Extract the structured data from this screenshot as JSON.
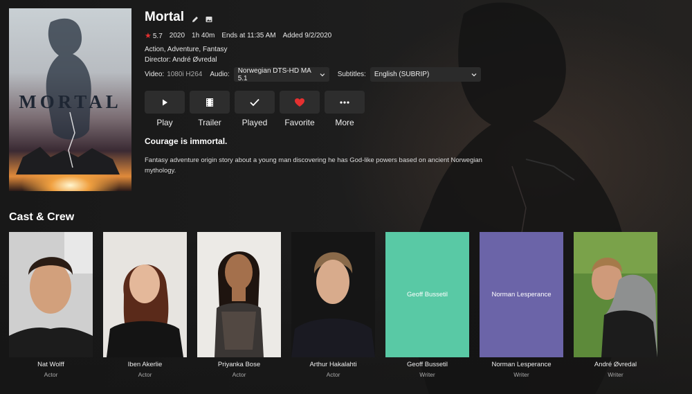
{
  "item": {
    "title": "Mortal",
    "poster_text": "MORTAL",
    "rating": "5.7",
    "year": "2020",
    "runtime": "1h 40m",
    "ends_at": "Ends at 11:35 AM",
    "added": "Added 9/2/2020",
    "genres": "Action, Adventure, Fantasy",
    "director": "Director: André Øvredal",
    "tagline": "Courage is immortal.",
    "overview": "Fantasy adventure origin story about a young man discovering he has God-like powers based on ancient Norwegian mythology."
  },
  "media": {
    "video_label": "Video:",
    "video_value": "1080i H264",
    "audio_label": "Audio:",
    "audio_value": "Norwegian DTS-HD MA 5.1",
    "subtitles_label": "Subtitles:",
    "subtitles_value": "English (SUBRIP)"
  },
  "actions": [
    {
      "label": "Play",
      "icon": "play-icon"
    },
    {
      "label": "Trailer",
      "icon": "film-icon"
    },
    {
      "label": "Played",
      "icon": "check-icon"
    },
    {
      "label": "Favorite",
      "icon": "heart-icon"
    },
    {
      "label": "More",
      "icon": "more-icon"
    }
  ],
  "cast_section": {
    "title": "Cast & Crew"
  },
  "cast": [
    {
      "name": "Nat Wolff",
      "role": "Actor"
    },
    {
      "name": "Iben Akerlie",
      "role": "Actor"
    },
    {
      "name": "Priyanka Bose",
      "role": "Actor"
    },
    {
      "name": "Arthur Hakalahti",
      "role": "Actor"
    },
    {
      "name": "Geoff Bussetil",
      "role": "Writer",
      "placeholder": "Geoff Bussetil"
    },
    {
      "name": "Norman Lesperance",
      "role": "Writer",
      "placeholder": "Norman Lesperance"
    },
    {
      "name": "André Øvredal",
      "role": "Writer"
    }
  ],
  "colors": {
    "favorite": "#e53030",
    "placeholder_green": "#59c9a5",
    "placeholder_purple": "#6b64a8",
    "button_bg": "#2d2d2d"
  }
}
